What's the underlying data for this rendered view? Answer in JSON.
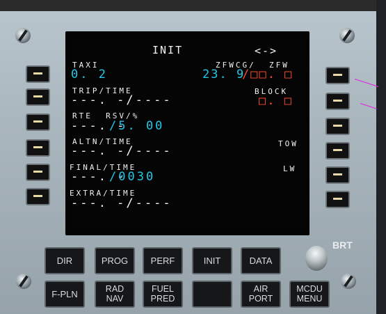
{
  "screen": {
    "title": "INIT",
    "arrows": "<->",
    "left": [
      {
        "label": "TAXI",
        "value": "0. 2"
      },
      {
        "label": "TRIP/TIME",
        "value": "---. -/----"
      },
      {
        "label": "RTE  RSV/%",
        "value_dashes": "---. -",
        "value_slash": "/5. 00"
      },
      {
        "label": "ALTN/TIME",
        "value": "---. -/----"
      },
      {
        "label": "FINAL/TIME",
        "value_dashes": "---. -",
        "value_slash": "/0030"
      },
      {
        "label": "EXTRA/TIME",
        "value": "---. -/----"
      }
    ],
    "right": {
      "zfwcg_label": "ZFWCG/  ZFW",
      "zfwcg_value": "23. 9",
      "zfw_value": "/□□. □",
      "block_label": "BLOCK",
      "block_value": "□. □",
      "tow_label": "TOW",
      "lw_label": "LW"
    }
  },
  "keys": {
    "dir": "DIR",
    "prog": "PROG",
    "perf": "PERF",
    "init": "INIT",
    "data": "DATA",
    "fpln": "F-PLN",
    "rad_nav": "RAD NAV",
    "fuel_pred": "FUEL PRED",
    "air_port": "AIR PORT",
    "mcdu_menu": "MCDU MENU"
  },
  "brt_label": "BRT",
  "colors": {
    "cyan": "#21c7e6",
    "amber_box": "#ff4a2d",
    "white": "#f4f4f4"
  }
}
